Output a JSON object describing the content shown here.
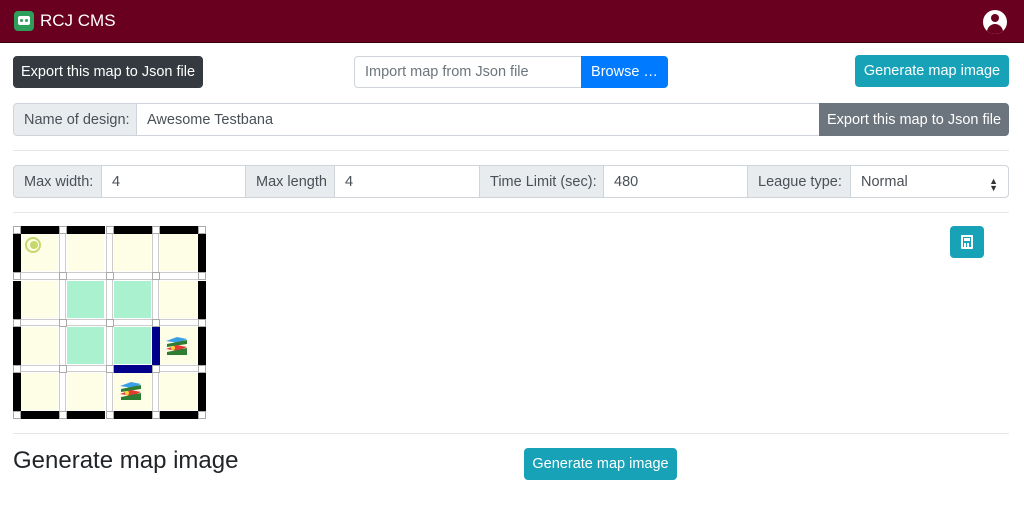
{
  "app": {
    "title": "RCJ CMS"
  },
  "toolbar": {
    "export_json_label": "Export this map to Json file",
    "import_placeholder": "Import map from Json file",
    "browse_label": "Browse …",
    "generate_image_label": "Generate map image"
  },
  "design": {
    "name_label": "Name of design:",
    "name_value": "Awesome Testbana",
    "export_label": "Export this map to Json file"
  },
  "settings": {
    "max_width_label": "Max width:",
    "max_width_value": "4",
    "max_length_label": "Max length",
    "max_length_value": "4",
    "time_limit_label": "Time Limit (sec):",
    "time_limit_value": "480",
    "league_label": "League type:",
    "league_value": "Normal"
  },
  "map": {
    "cols": 4,
    "rows": 4,
    "tile_colors": {
      "normal": "#fefde6",
      "checkpoint": "#aaf2cf"
    },
    "wall_colors": {
      "wall": "#000000",
      "special": "#00008b"
    }
  },
  "generate_section": {
    "title": "Generate map image",
    "button_label": "Generate map image"
  },
  "icons": [
    "robot-icon",
    "user-icon",
    "calculator-icon",
    "start-icon",
    "victim-icon"
  ]
}
